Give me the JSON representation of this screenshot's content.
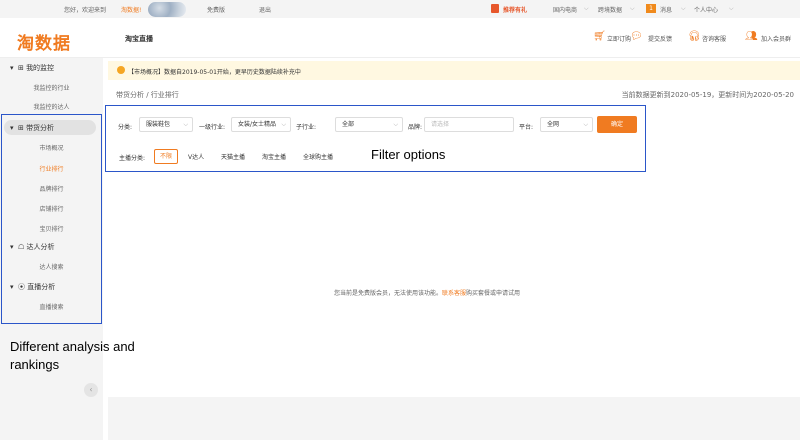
{
  "topbar": {
    "welcome": "您好，欢迎来到",
    "brand_link": "淘数据!",
    "free_edition": "免费版",
    "logout": "退出",
    "promo": "推荐有礼",
    "domestic": "国内电商",
    "crossborder": "跨境数据",
    "msg_count": "1",
    "messages": "消息",
    "user_center": "个人中心"
  },
  "header": {
    "logo": "淘数据",
    "page_title": "淘宝直播",
    "order": "立即订购",
    "feedback": "提交反馈",
    "support": "咨询客服",
    "join": "加入会员群"
  },
  "sidebar": {
    "groups": [
      {
        "label": "我的监控",
        "items": [
          "我监控的行业",
          "我监控的达人"
        ]
      },
      {
        "label": "带货分析",
        "items": [
          "市场概况",
          "行业排行",
          "品牌排行",
          "店铺排行",
          "宝贝排行"
        ]
      },
      {
        "label": "达人分析",
        "items": [
          "达人搜索"
        ]
      },
      {
        "label": "直播分析",
        "items": [
          "直播搜索"
        ]
      }
    ],
    "active_item": "行业排行"
  },
  "main": {
    "notice_tag": "【市场概况】",
    "notice_text": "数据自2019-05-01开始，更早历史数据陆续补充中",
    "breadcrumb": "带货分析  /  行业排行",
    "updated": "当前数据更新到2020-05-19，更新时间为2020-05-20"
  },
  "filters": {
    "category_label": "分类:",
    "category_value": "服装鞋包",
    "level1_label": "一级行业:",
    "level1_value": "女装/女士精品",
    "sub_label": "子行业:",
    "sub_value": "全部",
    "brand_label": "品牌:",
    "brand_placeholder": "请选择",
    "platform_label": "平台:",
    "platform_value": "全网",
    "confirm": "确定",
    "streamer_label": "主播分类:",
    "streamer_tags": [
      "不限",
      "V达人",
      "天猫主播",
      "淘宝主播",
      "全球购主播"
    ]
  },
  "empty": {
    "prefix": "您当前是免费版会员，无法使用该功能。",
    "link": "联系客服",
    "suffix": "购买套餐或申请试用"
  },
  "annotations": {
    "filter_label": "Filter options",
    "sidebar_label_line1": "Different analysis and",
    "sidebar_label_line2": "rankings"
  },
  "colors": {
    "accent": "#f07b21",
    "annotation_blue": "#2b56c9"
  }
}
